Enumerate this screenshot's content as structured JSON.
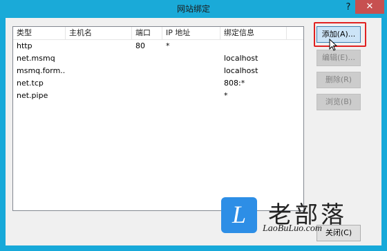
{
  "window": {
    "title": "网站绑定",
    "help_glyph": "?",
    "close_glyph": "✕"
  },
  "list": {
    "columns": [
      "类型",
      "主机名",
      "端口",
      "IP 地址",
      "绑定信息"
    ],
    "rows": [
      {
        "type": "http",
        "host": "",
        "port": "80",
        "ip": "*",
        "binding": ""
      },
      {
        "type": "net.msmq",
        "host": "",
        "port": "",
        "ip": "",
        "binding": "localhost"
      },
      {
        "type": "msmq.form...",
        "host": "",
        "port": "",
        "ip": "",
        "binding": "localhost"
      },
      {
        "type": "net.tcp",
        "host": "",
        "port": "",
        "ip": "",
        "binding": "808:*"
      },
      {
        "type": "net.pipe",
        "host": "",
        "port": "",
        "ip": "",
        "binding": "*"
      }
    ]
  },
  "buttons": {
    "add": "添加(A)...",
    "edit": "编辑(E)...",
    "remove": "删除(R)",
    "browse": "浏览(B)",
    "close": "关闭(C)"
  },
  "watermark": {
    "logo_letter": "L",
    "name": "老部落",
    "url": "LaoBuLuo.com"
  },
  "colors": {
    "titlebar": "#1aaad8",
    "close_button": "#c75050",
    "highlight": "#e02020",
    "logo": "#2d8ee6"
  }
}
